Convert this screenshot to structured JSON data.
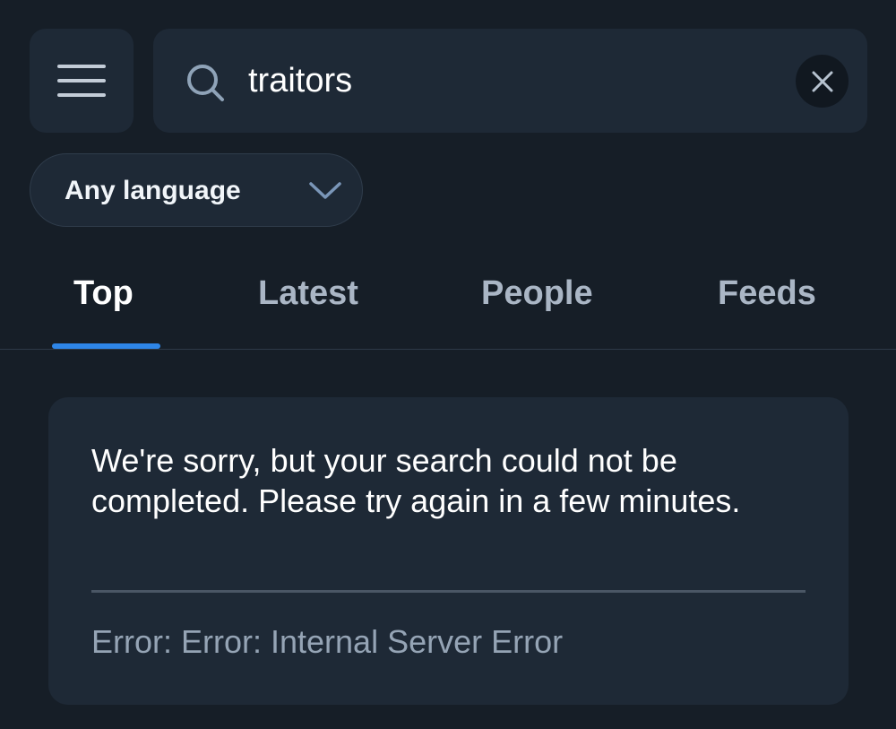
{
  "header": {
    "menu_icon": "hamburger-menu-icon",
    "search": {
      "icon": "search-icon",
      "value": "traitors",
      "clear_icon": "close-icon"
    }
  },
  "filters": {
    "language": {
      "selected": "Any language",
      "icon": "chevron-down-icon"
    }
  },
  "tabs": [
    {
      "label": "Top",
      "active": true
    },
    {
      "label": "Latest",
      "active": false
    },
    {
      "label": "People",
      "active": false
    },
    {
      "label": "Feeds",
      "active": false
    }
  ],
  "error": {
    "message": "We're sorry, but your search could not be completed. Please try again in a few minutes.",
    "detail": "Error: Error: Internal Server Error"
  },
  "colors": {
    "background": "#161e27",
    "surface": "#1e2936",
    "accent": "#2e86e8",
    "muted_text": "#95a4b5"
  }
}
